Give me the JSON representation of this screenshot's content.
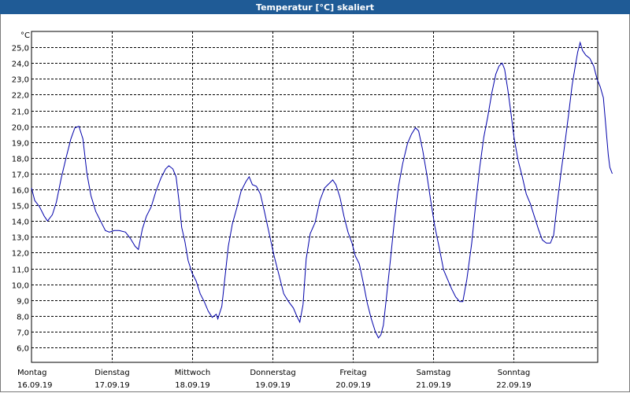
{
  "window": {
    "title": "Temperatur [°C] skaliert"
  },
  "chart_data": {
    "type": "line",
    "title": "Temperatur [°C] skaliert",
    "ylabel": "°C",
    "ylim": [
      6,
      26
    ],
    "xlim": [
      0,
      7
    ],
    "y_ticks": [
      "6,0",
      "7,0",
      "8,0",
      "9,0",
      "10,0",
      "11,0",
      "12,0",
      "13,0",
      "14,0",
      "15,0",
      "16,0",
      "17,0",
      "18,0",
      "19,0",
      "20,0",
      "21,0",
      "22,0",
      "23,0",
      "24,0",
      "25,0"
    ],
    "x_ticks": [
      {
        "day": "Montag",
        "date": "16.09.19"
      },
      {
        "day": "Dienstag",
        "date": "17.09.19"
      },
      {
        "day": "Mittwoch",
        "date": "18.09.19"
      },
      {
        "day": "Donnerstag",
        "date": "19.09.19"
      },
      {
        "day": "Freitag",
        "date": "20.09.19"
      },
      {
        "day": "Samstag",
        "date": "21.09.19"
      },
      {
        "day": "Sonntag",
        "date": "22.09.19"
      }
    ],
    "grid": true,
    "colors": {
      "line": "#0000aa",
      "grid": "#000000",
      "titlebar": "#1f5b96"
    },
    "series": [
      {
        "points": [
          [
            0.0,
            16.1
          ],
          [
            0.04,
            15.3
          ],
          [
            0.1,
            14.9
          ],
          [
            0.16,
            14.3
          ],
          [
            0.2,
            14.0
          ],
          [
            0.26,
            14.4
          ],
          [
            0.31,
            15.2
          ],
          [
            0.37,
            16.7
          ],
          [
            0.43,
            18.0
          ],
          [
            0.49,
            19.2
          ],
          [
            0.54,
            19.9
          ],
          [
            0.59,
            20.0
          ],
          [
            0.64,
            19.2
          ],
          [
            0.69,
            17.0
          ],
          [
            0.74,
            15.6
          ],
          [
            0.8,
            14.6
          ],
          [
            0.86,
            14.0
          ],
          [
            0.92,
            13.4
          ],
          [
            0.97,
            13.3
          ],
          [
            1.03,
            13.4
          ],
          [
            1.09,
            13.4
          ],
          [
            1.17,
            13.3
          ],
          [
            1.23,
            12.9
          ],
          [
            1.29,
            12.4
          ],
          [
            1.33,
            12.2
          ],
          [
            1.38,
            13.5
          ],
          [
            1.43,
            14.3
          ],
          [
            1.49,
            14.9
          ],
          [
            1.55,
            15.9
          ],
          [
            1.61,
            16.7
          ],
          [
            1.67,
            17.3
          ],
          [
            1.71,
            17.5
          ],
          [
            1.76,
            17.3
          ],
          [
            1.8,
            16.8
          ],
          [
            1.84,
            15.1
          ],
          [
            1.87,
            13.6
          ],
          [
            1.91,
            12.7
          ],
          [
            1.95,
            11.5
          ],
          [
            2.0,
            10.7
          ],
          [
            2.05,
            10.2
          ],
          [
            2.1,
            9.4
          ],
          [
            2.15,
            8.9
          ],
          [
            2.2,
            8.3
          ],
          [
            2.25,
            7.9
          ],
          [
            2.3,
            8.1
          ],
          [
            2.32,
            7.8
          ],
          [
            2.37,
            8.6
          ],
          [
            2.41,
            10.5
          ],
          [
            2.45,
            12.4
          ],
          [
            2.5,
            13.8
          ],
          [
            2.56,
            14.9
          ],
          [
            2.61,
            15.9
          ],
          [
            2.67,
            16.5
          ],
          [
            2.71,
            16.8
          ],
          [
            2.75,
            16.3
          ],
          [
            2.8,
            16.2
          ],
          [
            2.85,
            15.7
          ],
          [
            2.9,
            14.6
          ],
          [
            2.96,
            13.2
          ],
          [
            3.02,
            11.8
          ],
          [
            3.08,
            10.6
          ],
          [
            3.14,
            9.4
          ],
          [
            3.2,
            8.9
          ],
          [
            3.26,
            8.5
          ],
          [
            3.31,
            7.9
          ],
          [
            3.34,
            7.6
          ],
          [
            3.38,
            8.7
          ],
          [
            3.42,
            11.6
          ],
          [
            3.47,
            13.2
          ],
          [
            3.53,
            13.9
          ],
          [
            3.59,
            15.3
          ],
          [
            3.65,
            16.1
          ],
          [
            3.71,
            16.4
          ],
          [
            3.75,
            16.6
          ],
          [
            3.79,
            16.3
          ],
          [
            3.84,
            15.5
          ],
          [
            3.89,
            14.3
          ],
          [
            3.94,
            13.3
          ],
          [
            3.99,
            12.6
          ],
          [
            4.03,
            11.8
          ],
          [
            4.08,
            11.3
          ],
          [
            4.13,
            10.1
          ],
          [
            4.18,
            8.8
          ],
          [
            4.23,
            7.8
          ],
          [
            4.28,
            7.0
          ],
          [
            4.32,
            6.6
          ],
          [
            4.35,
            6.8
          ],
          [
            4.38,
            7.4
          ],
          [
            4.42,
            9.2
          ],
          [
            4.47,
            11.6
          ],
          [
            4.52,
            14.1
          ],
          [
            4.57,
            16.2
          ],
          [
            4.62,
            17.6
          ],
          [
            4.68,
            18.9
          ],
          [
            4.73,
            19.5
          ],
          [
            4.78,
            19.9
          ],
          [
            4.82,
            19.7
          ],
          [
            4.87,
            18.5
          ],
          [
            4.92,
            17.0
          ],
          [
            4.97,
            15.3
          ],
          [
            5.02,
            13.7
          ],
          [
            5.08,
            12.2
          ],
          [
            5.13,
            10.9
          ],
          [
            5.18,
            10.3
          ],
          [
            5.23,
            9.7
          ],
          [
            5.28,
            9.2
          ],
          [
            5.33,
            8.9
          ],
          [
            5.37,
            8.9
          ],
          [
            5.42,
            10.3
          ],
          [
            5.48,
            12.6
          ],
          [
            5.53,
            15.1
          ],
          [
            5.58,
            17.4
          ],
          [
            5.63,
            19.3
          ],
          [
            5.68,
            20.6
          ],
          [
            5.73,
            22.1
          ],
          [
            5.78,
            23.3
          ],
          [
            5.82,
            23.8
          ],
          [
            5.86,
            24.0
          ],
          [
            5.89,
            23.6
          ],
          [
            5.93,
            22.3
          ],
          [
            5.97,
            20.8
          ],
          [
            6.01,
            19.2
          ],
          [
            6.06,
            17.8
          ],
          [
            6.11,
            16.8
          ],
          [
            6.16,
            15.7
          ],
          [
            6.21,
            15.1
          ],
          [
            6.26,
            14.3
          ],
          [
            6.31,
            13.5
          ],
          [
            6.36,
            12.8
          ],
          [
            6.41,
            12.6
          ],
          [
            6.46,
            12.6
          ],
          [
            6.5,
            13.1
          ],
          [
            6.54,
            14.9
          ],
          [
            6.59,
            17.0
          ],
          [
            6.64,
            18.9
          ],
          [
            6.69,
            20.9
          ],
          [
            6.73,
            22.6
          ],
          [
            6.77,
            23.8
          ],
          [
            6.8,
            24.7
          ],
          [
            6.83,
            25.3
          ],
          [
            6.86,
            24.8
          ],
          [
            6.9,
            24.5
          ],
          [
            6.95,
            24.3
          ],
          [
            7.0,
            23.8
          ],
          [
            7.04,
            23.0
          ],
          [
            7.08,
            22.5
          ],
          [
            7.12,
            21.8
          ],
          [
            7.15,
            20.0
          ],
          [
            7.18,
            18.2
          ],
          [
            7.2,
            17.4
          ],
          [
            7.23,
            17.0
          ]
        ]
      }
    ]
  }
}
